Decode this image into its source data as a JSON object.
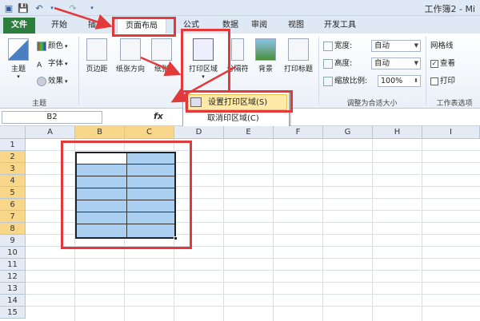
{
  "window": {
    "title": "工作簿2 - Mi"
  },
  "tabs": [
    {
      "label": "文件"
    },
    {
      "label": "开始"
    },
    {
      "label": "插入"
    },
    {
      "label": "页面布局"
    },
    {
      "label": "公式"
    },
    {
      "label": "数据"
    },
    {
      "label": "审阅"
    },
    {
      "label": "视图"
    },
    {
      "label": "开发工具"
    }
  ],
  "ribbon": {
    "theme": {
      "main": "主题",
      "colors": "颜色",
      "fonts": "字体",
      "effects": "效果",
      "group": "主题"
    },
    "page_setup": {
      "margins": "页边距",
      "orientation": "纸张方向",
      "size": "纸张",
      "print_area": "打印区域",
      "breaks": "分隔符",
      "background": "背景",
      "print_titles": "打印标题"
    },
    "scale": {
      "width_label": "宽度:",
      "width_value": "自动",
      "height_label": "高度:",
      "height_value": "自动",
      "zoom_label": "缩放比例:",
      "zoom_value": "100%",
      "group": "调整为合适大小"
    },
    "sheet_options": {
      "gridlines": "网格线",
      "view": "查看",
      "print": "打印",
      "group": "工作表选项"
    }
  },
  "print_area_menu": {
    "set": "设置打印区域(S)",
    "clear": "取消印区域(C)"
  },
  "formula_bar": {
    "name_box": "B2",
    "fx": "fx"
  },
  "grid": {
    "columns": [
      "A",
      "B",
      "C",
      "D",
      "E",
      "F",
      "G",
      "H",
      "I"
    ],
    "rows": [
      "1",
      "2",
      "3",
      "4",
      "5",
      "6",
      "7",
      "8",
      "9",
      "10",
      "11",
      "12",
      "13",
      "14",
      "15"
    ]
  },
  "colors": {
    "file_tab": "#2d7d3c",
    "annotation": "#e23a3a",
    "selection_fill": "#aacff0"
  }
}
